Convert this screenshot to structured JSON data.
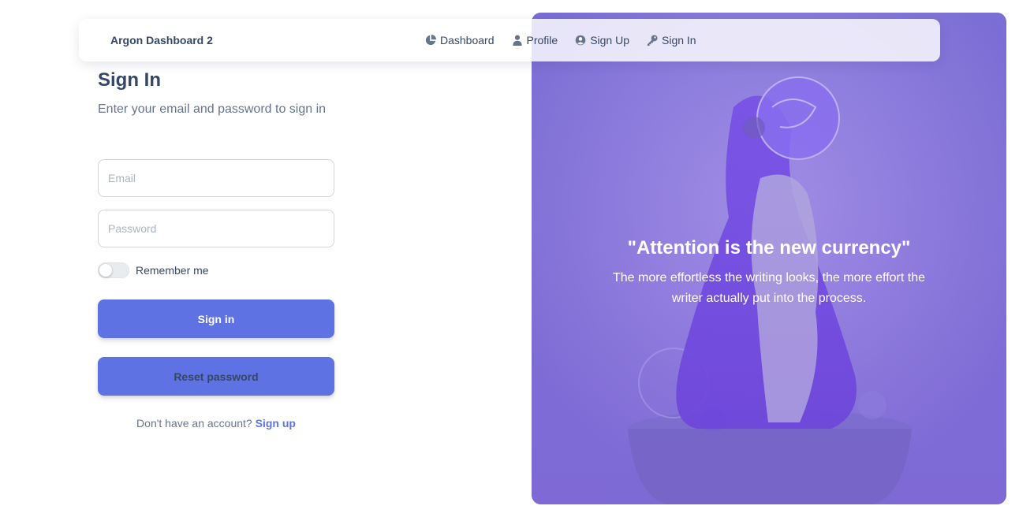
{
  "navbar": {
    "brand": "Argon Dashboard 2",
    "links": [
      {
        "label": "Dashboard",
        "icon": "pie-chart-icon"
      },
      {
        "label": "Profile",
        "icon": "user-icon"
      },
      {
        "label": "Sign Up",
        "icon": "user-circle-icon"
      },
      {
        "label": "Sign In",
        "icon": "key-icon"
      }
    ]
  },
  "signin": {
    "title": "Sign In",
    "subtitle": "Enter your email and password to sign in",
    "email_placeholder": "Email",
    "password_placeholder": "Password",
    "remember_label": "Remember me",
    "remember_checked": false,
    "signin_button": "Sign in",
    "reset_button": "Reset password",
    "no_account_text": "Don't have an account?",
    "signup_link": "Sign up"
  },
  "hero": {
    "quote": "\"Attention is the new currency\"",
    "subtitle": "The more effortless the writing looks, the more effort the writer actually put into the process."
  },
  "colors": {
    "primary": "#5e72e4",
    "heading": "#344767",
    "muted": "#67748e",
    "hero_tint": "#8b78d8"
  }
}
